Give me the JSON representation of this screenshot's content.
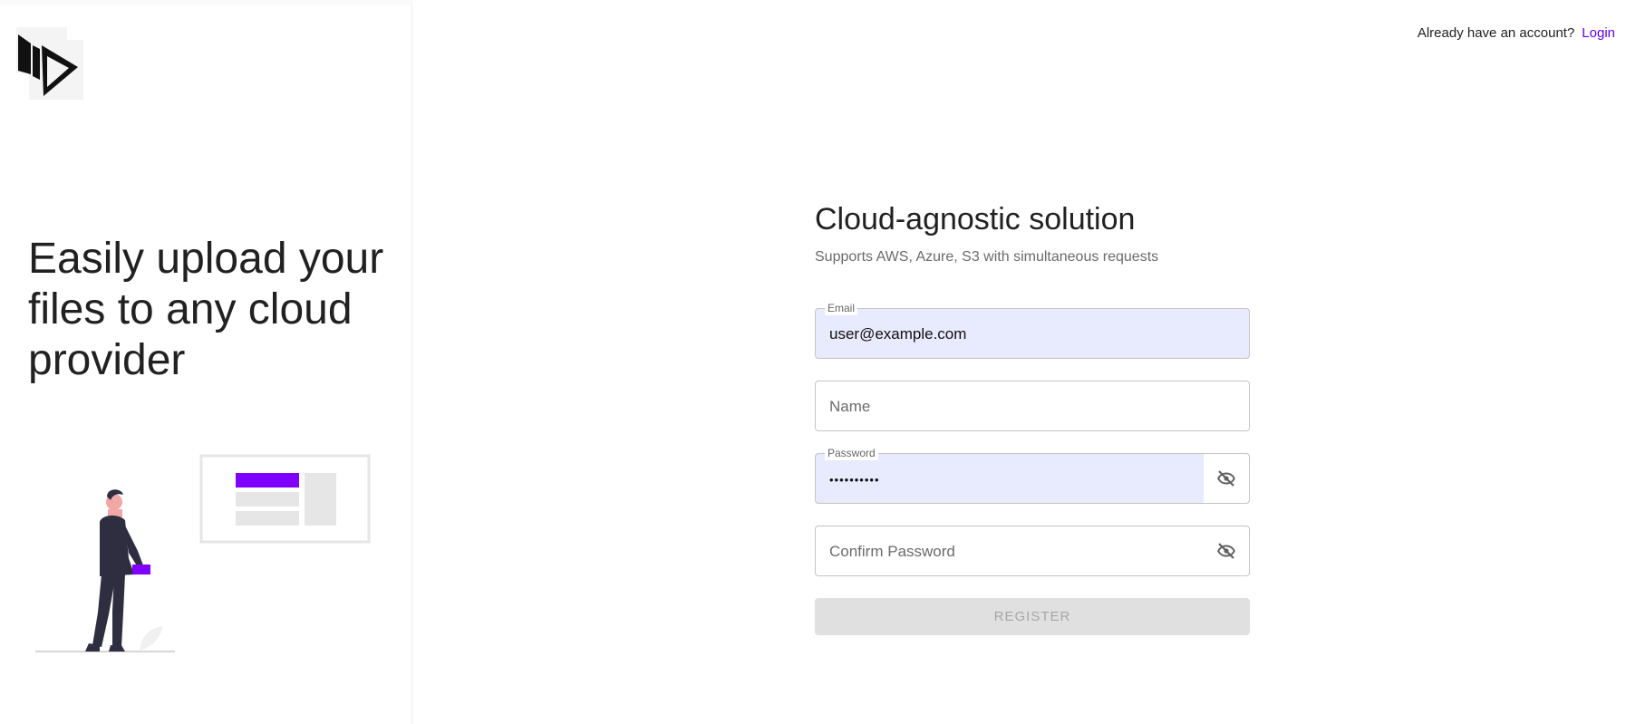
{
  "left": {
    "headline": "Easily upload your files to any cloud provider"
  },
  "header": {
    "question": "Already have an account?",
    "login_label": "Login"
  },
  "form": {
    "title": "Cloud-agnostic solution",
    "subtitle": "Supports AWS, Azure, S3 with simultaneous requests",
    "email": {
      "label": "Email",
      "value": "user@example.com"
    },
    "name": {
      "placeholder": "Name",
      "value": ""
    },
    "password": {
      "label": "Password",
      "value": "••••••••••"
    },
    "confirm_password": {
      "placeholder": "Confirm Password",
      "value": ""
    },
    "register_label": "REGISTER"
  },
  "colors": {
    "accent": "#6200ee",
    "illustration_accent": "#8000ff",
    "autofill_bg": "#e8eafd",
    "disabled_button_bg": "#e0e0e0"
  },
  "icons": {
    "password_toggle": "eye-off-icon",
    "confirm_toggle": "eye-off-icon",
    "logo": "brand-logo"
  }
}
